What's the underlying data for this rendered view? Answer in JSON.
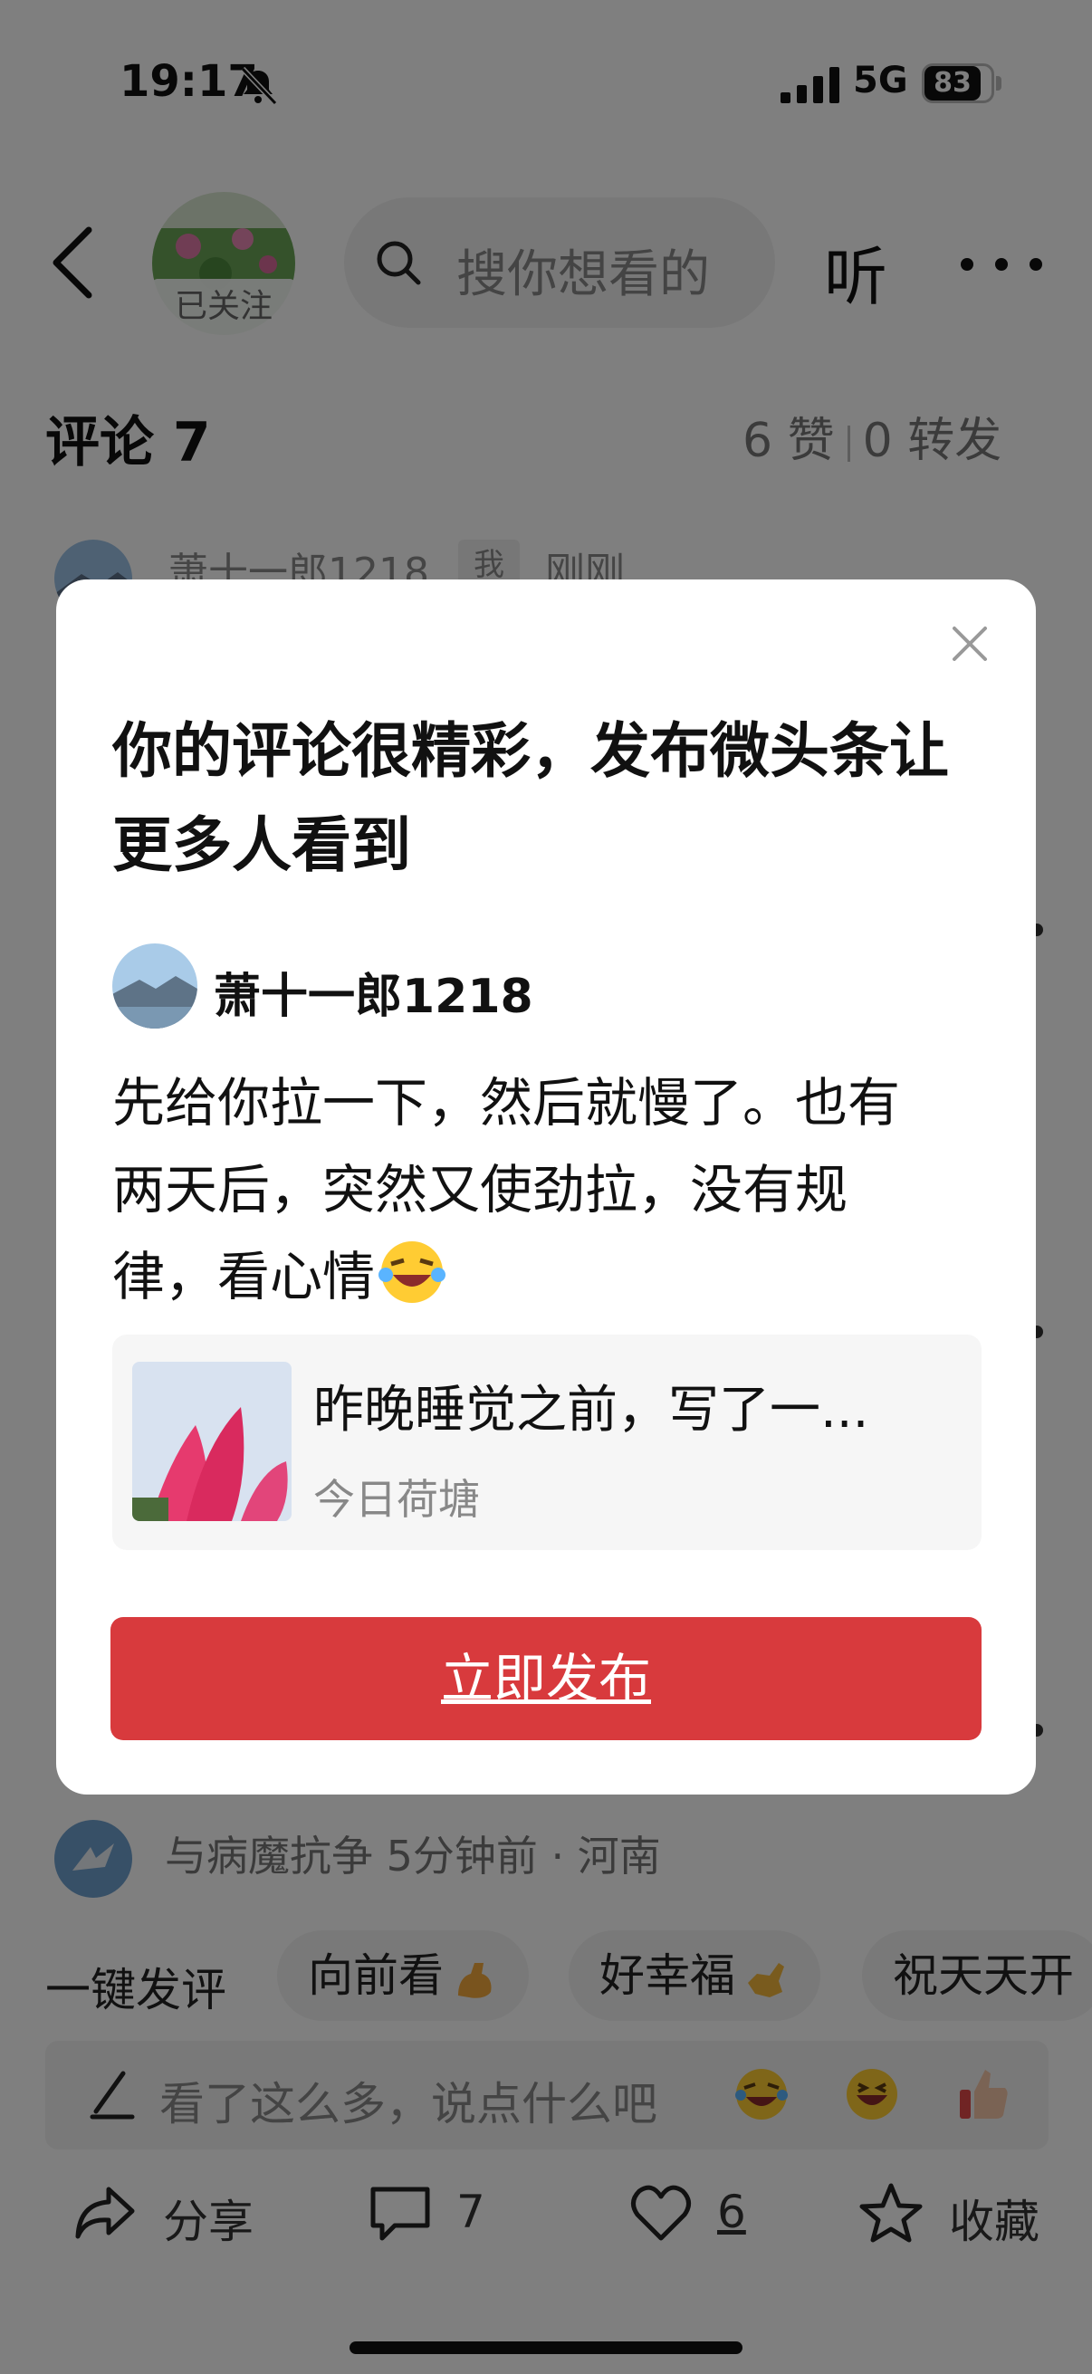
{
  "status_bar": {
    "time": "19:17",
    "network": "5G",
    "battery": "83"
  },
  "header": {
    "follow_badge": "已关注",
    "search_placeholder": "搜你想看的",
    "listen_label": "听"
  },
  "comments_section": {
    "title": "评论 7",
    "likes": "6 赞",
    "shares": "0 转发",
    "comments": [
      {
        "name": "萧十一郎1218",
        "badge": "我",
        "time": "刚刚"
      },
      {
        "meta": "与病魔抗争  5分钟前 · 河南"
      }
    ]
  },
  "quick_reply": {
    "label": "一键发评",
    "chips": [
      "向前看",
      "好幸福",
      "祝天天开"
    ]
  },
  "input_bar": {
    "placeholder": "看了这么多，说点什么吧"
  },
  "bottom_bar": {
    "share_label": "分享",
    "comment_count": "7",
    "like_count": "6",
    "favorite_label": "收藏"
  },
  "modal": {
    "title": "你的评论很精彩，发布微头条让更多人看到",
    "author_name": "萧十一郎1218",
    "comment_text": "先给你拉一下，然后就慢了。也有两天后，突然又使劲拉，没有规律，看心情",
    "article_title": "昨晚睡觉之前，写了一...",
    "article_source": "今日荷塘",
    "publish_button": "立即发布"
  },
  "colors": {
    "accent_red": "#d83a3d",
    "overlay": "rgba(0,0,0,0.5)"
  },
  "icons": [
    "bell-off-icon",
    "signal-icon",
    "battery-icon",
    "back-icon",
    "search-icon",
    "more-icon",
    "pen-icon",
    "share-icon",
    "comment-icon",
    "heart-icon",
    "star-icon",
    "close-icon",
    "laughing-emoji-icon",
    "grin-emoji-icon",
    "thumbs-up-emoji-icon",
    "muscle-emoji-icon"
  ]
}
